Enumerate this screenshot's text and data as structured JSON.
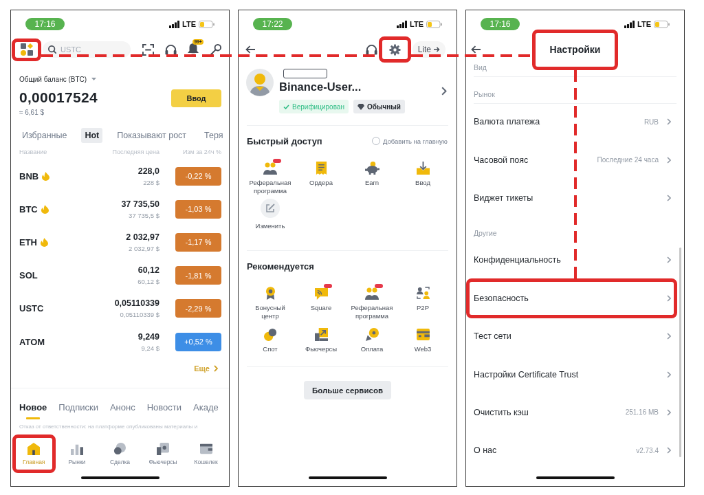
{
  "home_screen": {
    "status_bar": {
      "time": "17:16",
      "network": "LTE"
    },
    "toolbar": {
      "menu_highlighted": true,
      "search": {
        "placeholder": "USTC"
      },
      "notification_badge": "99+"
    },
    "balance": {
      "label": "Общий баланс (BTC)",
      "amount": "0,00017524",
      "fiat_value": "≈ 6,61 $",
      "deposit_button": "Ввод"
    },
    "market_tabs": [
      {
        "label": "Избранные",
        "selected": false
      },
      {
        "label": "Hot",
        "selected": true
      },
      {
        "label": "Показывают рост",
        "selected": false
      },
      {
        "label": "Теря",
        "selected": false
      }
    ],
    "market_table": {
      "columns": [
        "Название",
        "Последняя цена",
        "Изм за 24ч %"
      ],
      "rows": [
        {
          "name": "BNB",
          "hot": true,
          "price": "228,0",
          "fiat_price": "228 $",
          "change": "-0,22 %",
          "color": "#d57a2f"
        },
        {
          "name": "BTC",
          "hot": true,
          "price": "37 735,50",
          "fiat_price": "37 735,5 $",
          "change": "-1,03 %",
          "color": "#d57a2f"
        },
        {
          "name": "ETH",
          "hot": true,
          "price": "2 032,97",
          "fiat_price": "2 032,97 $",
          "change": "-1,17 %",
          "color": "#d57a2f"
        },
        {
          "name": "SOL",
          "hot": false,
          "price": "60,12",
          "fiat_price": "60,12 $",
          "change": "-1,81 %",
          "color": "#d57a2f"
        },
        {
          "name": "USTC",
          "hot": false,
          "price": "0,05110339",
          "fiat_price": "0,05110339 $",
          "change": "-2,29 %",
          "color": "#d57a2f"
        },
        {
          "name": "ATOM",
          "hot": false,
          "price": "9,249",
          "fiat_price": "9,24 $",
          "change": "+0,52 %",
          "color": "#3d8ee6"
        }
      ]
    },
    "more_link": "Еще",
    "news_tabs": [
      {
        "label": "Новое",
        "selected": true
      },
      {
        "label": "Подписки",
        "selected": false
      },
      {
        "label": "Анонс",
        "selected": false
      },
      {
        "label": "Новости",
        "selected": false
      },
      {
        "label": "Акаде",
        "selected": false
      }
    ],
    "disclaimer": "Отказ от ответственности: на платформе опубликованы материалы и",
    "bottom_nav": [
      {
        "label": "Главная",
        "selected": true,
        "highlighted": true
      },
      {
        "label": "Рынки",
        "selected": false,
        "highlighted": false
      },
      {
        "label": "Сделка",
        "selected": false,
        "highlighted": false
      },
      {
        "label": "Фьючерсы",
        "selected": false,
        "highlighted": false
      },
      {
        "label": "Кошелек",
        "selected": false,
        "highlighted": false
      }
    ]
  },
  "account_screen": {
    "status_bar": {
      "time": "17:22",
      "network": "LTE"
    },
    "toolbar": {
      "settings_highlighted": true,
      "mode_button": "Lite"
    },
    "profile": {
      "name": "Binance-User...",
      "badges": [
        {
          "label": "Верифицирован",
          "kind": "verified"
        },
        {
          "label": "Обычный",
          "kind": "tier"
        }
      ]
    },
    "quick_access": {
      "title": "Быстрый доступ",
      "add_to_home": {
        "label": "Добавить на главную",
        "checked": false
      },
      "items": [
        {
          "label": "Реферальная программа",
          "new_badge": true
        },
        {
          "label": "Ордера",
          "new_badge": false
        },
        {
          "label": "Earn",
          "new_badge": false
        },
        {
          "label": "Ввод",
          "new_badge": false
        },
        {
          "label": "Изменить",
          "new_badge": false
        }
      ]
    },
    "recommended": {
      "title": "Рекомендуется",
      "items": [
        {
          "label": "Бонусный центр",
          "new_badge": false
        },
        {
          "label": "Square",
          "new_badge": true
        },
        {
          "label": "Реферальная программа",
          "new_badge": true
        },
        {
          "label": "P2P",
          "new_badge": false
        },
        {
          "label": "Спот",
          "new_badge": false
        },
        {
          "label": "Фьючерсы",
          "new_badge": false
        },
        {
          "label": "Оплата",
          "new_badge": false
        },
        {
          "label": "Web3",
          "new_badge": false
        }
      ]
    },
    "more_services_button": "Больше сервисов"
  },
  "settings_screen": {
    "status_bar": {
      "time": "17:16",
      "network": "LTE"
    },
    "header": {
      "title": "Настройки",
      "highlighted": true
    },
    "sections": [
      {
        "title": "Вид"
      },
      {
        "title": "Рынок",
        "items": [
          {
            "label": "Валюта платежа",
            "value": "RUB",
            "highlighted": false
          },
          {
            "label": "Часовой пояс",
            "value": "Последние 24 часа",
            "highlighted": false
          },
          {
            "label": "Виджет тикеты",
            "highlighted": false
          }
        ]
      },
      {
        "title": "Другие",
        "items": [
          {
            "label": "Конфиденциальность",
            "highlighted": false
          },
          {
            "label": "Безопасность",
            "highlighted": true
          },
          {
            "label": "Тест сети",
            "highlighted": false
          },
          {
            "label": "Настройки Certificate Trust",
            "highlighted": false
          },
          {
            "label": "Очистить кэш",
            "value": "251.16 MB",
            "highlighted": false
          },
          {
            "label": "О нас",
            "value": "v2.73.4",
            "highlighted": false
          }
        ]
      }
    ]
  }
}
